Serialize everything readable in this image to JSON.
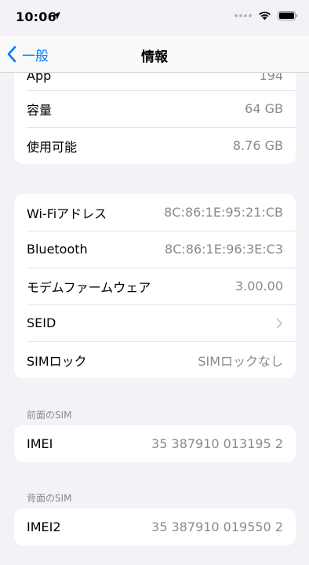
{
  "status_bar": {
    "time": "10:06",
    "icons": [
      "location-arrow-icon",
      "signal-dots-icon",
      "wifi-icon",
      "battery-icon"
    ]
  },
  "nav": {
    "back_label": "一般",
    "title": "情報"
  },
  "capacity_group": {
    "rows": [
      {
        "label": "App",
        "value": "194"
      },
      {
        "label": "容量",
        "value": "64 GB"
      },
      {
        "label": "使用可能",
        "value": "8.76 GB"
      }
    ]
  },
  "network_group": {
    "rows": [
      {
        "label": "Wi-Fiアドレス",
        "value": "8C:86:1E:95:21:CB"
      },
      {
        "label": "Bluetooth",
        "value": "8C:86:1E:96:3E:C3"
      },
      {
        "label": "モデムファームウェア",
        "value": "3.00.00"
      },
      {
        "label": "SEID",
        "value": ""
      },
      {
        "label": "SIMロック",
        "value": "SIMロックなし"
      }
    ]
  },
  "front_sim": {
    "header": "前面のSIM",
    "rows": [
      {
        "label": "IMEI",
        "value": "35 387910 013195 2"
      }
    ]
  },
  "back_sim": {
    "header": "背面のSIM",
    "rows": [
      {
        "label": "IMEI2",
        "value": "35 387910 019550 2"
      }
    ]
  },
  "colors": {
    "accent": "#007aff",
    "background": "#f2f2f7",
    "secondary_text": "#8a8a8e"
  }
}
